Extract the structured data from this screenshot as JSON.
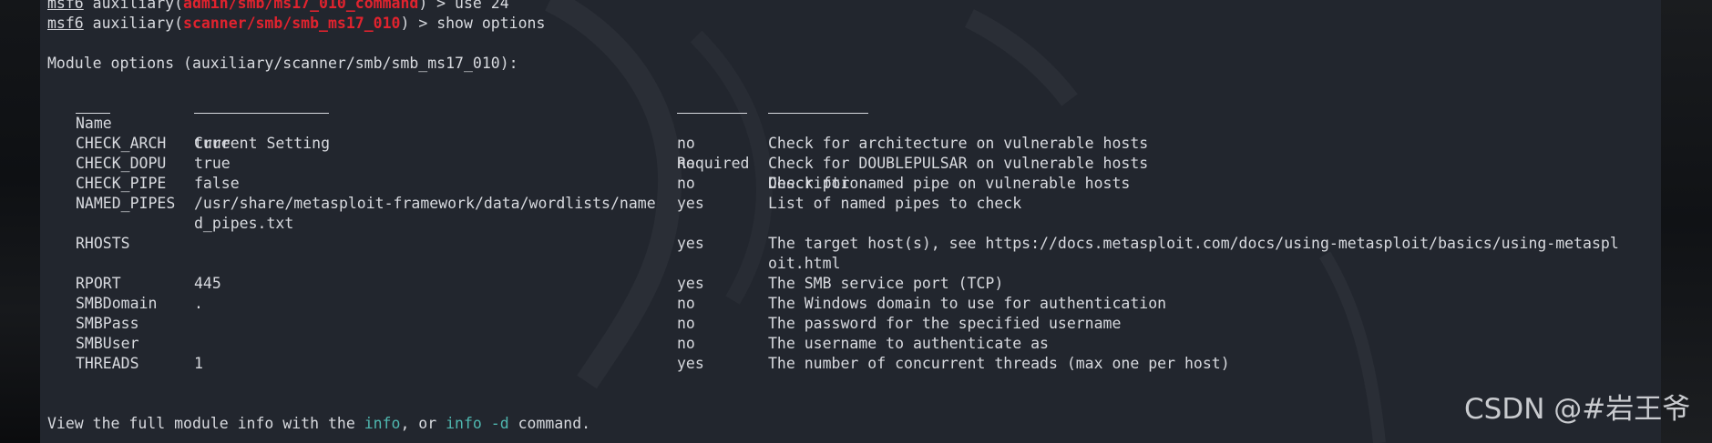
{
  "prompt_lines": [
    {
      "prompt": "msf6",
      "pre": " auxiliary(",
      "module": "admin/smb/ms17_010_command",
      "post": ") > use 24"
    },
    {
      "prompt": "msf6",
      "pre": " auxiliary(",
      "module": "scanner/smb/smb_ms17_010",
      "post": ") > show options"
    }
  ],
  "module_header": "Module options (auxiliary/scanner/smb/smb_ms17_010):",
  "table": {
    "columns": {
      "name": "Name",
      "setting": "Current Setting",
      "required": "Required",
      "description": "Description"
    },
    "rows": [
      {
        "name": "CHECK_ARCH",
        "setting": "true",
        "required": "no",
        "description": "Check for architecture on vulnerable hosts"
      },
      {
        "name": "CHECK_DOPU",
        "setting": "true",
        "required": "no",
        "description": "Check for DOUBLEPULSAR on vulnerable hosts"
      },
      {
        "name": "CHECK_PIPE",
        "setting": "false",
        "required": "no",
        "description": "Check for named pipe on vulnerable hosts"
      },
      {
        "name": "NAMED_PIPES",
        "setting": "/usr/share/metasploit-framework/data/wordlists/name",
        "required": "yes",
        "description": "List of named pipes to check"
      },
      {
        "name": "",
        "setting": "d_pipes.txt",
        "required": "",
        "description": ""
      },
      {
        "name": "RHOSTS",
        "setting": "",
        "required": "yes",
        "description": "The target host(s), see https://docs.metasploit.com/docs/using-metasploit/basics/using-metaspl"
      },
      {
        "name": "",
        "setting": "",
        "required": "",
        "description": "oit.html"
      },
      {
        "name": "RPORT",
        "setting": "445",
        "required": "yes",
        "description": "The SMB service port (TCP)"
      },
      {
        "name": "SMBDomain",
        "setting": ".",
        "required": "no",
        "description": "The Windows domain to use for authentication"
      },
      {
        "name": "SMBPass",
        "setting": "",
        "required": "no",
        "description": "The password for the specified username"
      },
      {
        "name": "SMBUser",
        "setting": "",
        "required": "no",
        "description": "The username to authenticate as"
      },
      {
        "name": "THREADS",
        "setting": "1",
        "required": "yes",
        "description": "The number of concurrent threads (max one per host)"
      }
    ]
  },
  "footer": {
    "pre": "View the full module info with the ",
    "link1": "info",
    "mid": ", or ",
    "link2": "info -d",
    "post": " command."
  },
  "watermark": "CSDN @#岩王爷",
  "colors": {
    "terminal_bg": "#22262e",
    "text": "#d8dadf",
    "module_red": "#e0232e",
    "link_cyan": "#4fb8b0"
  }
}
